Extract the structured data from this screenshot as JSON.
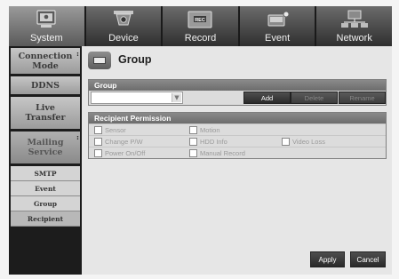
{
  "tabs": [
    {
      "label": "System",
      "icon": "system-icon",
      "active": true
    },
    {
      "label": "Device",
      "icon": "camera-icon",
      "active": false
    },
    {
      "label": "Record",
      "icon": "record-icon",
      "active": false
    },
    {
      "label": "Event",
      "icon": "event-icon",
      "active": false
    },
    {
      "label": "Network",
      "icon": "network-icon",
      "active": false
    }
  ],
  "sidebar": {
    "items": [
      {
        "label": "Connection Mode"
      },
      {
        "label": "DDNS"
      },
      {
        "label": "Live Transfer"
      },
      {
        "label": "Mailing Service"
      }
    ],
    "subitems": [
      {
        "label": "SMTP"
      },
      {
        "label": "Event"
      },
      {
        "label": "Group"
      },
      {
        "label": "Recipient"
      }
    ]
  },
  "page": {
    "title": "Group",
    "icon": "group-page-icon"
  },
  "group_panel": {
    "header": "Group",
    "select_value": "",
    "buttons": {
      "add": "Add",
      "delete": "Delete",
      "rename": "Rename"
    }
  },
  "permission_panel": {
    "header": "Recipient Permission",
    "rows": [
      [
        "Sensor",
        "Motion"
      ],
      [
        "Change P/W",
        "HDD Info",
        "Video Loss"
      ],
      [
        "Power On/Off",
        "Manual Record"
      ]
    ]
  },
  "footer": {
    "apply": "Apply",
    "cancel": "Cancel"
  }
}
